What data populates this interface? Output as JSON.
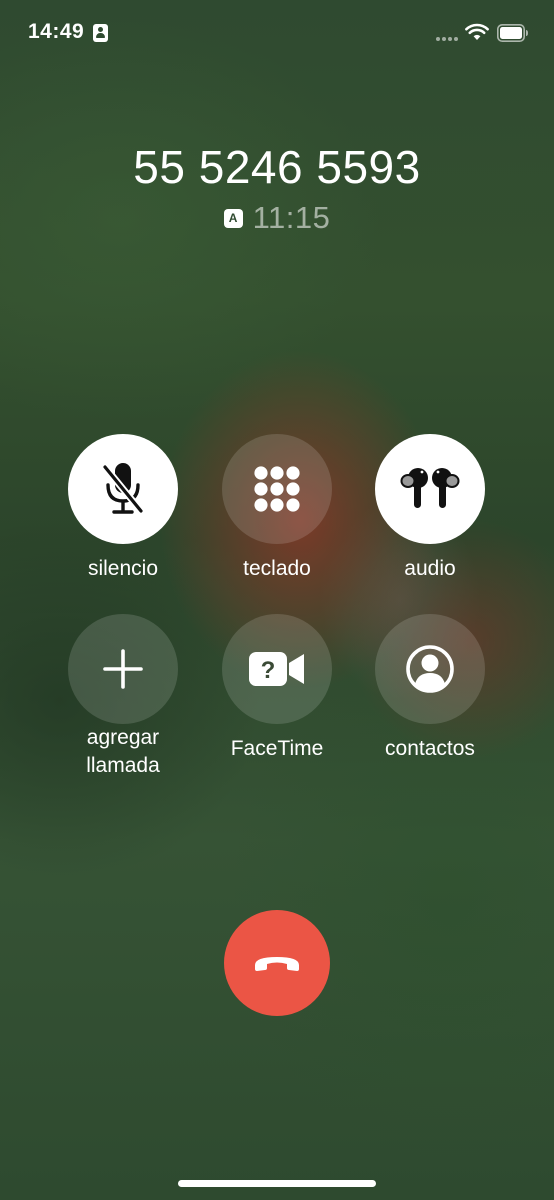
{
  "status_bar": {
    "time": "14:49",
    "icons": [
      "contact-badge-icon",
      "signal-icon",
      "wifi-icon",
      "battery-icon"
    ]
  },
  "call": {
    "number": "55 5246 5593",
    "sim_label": "A",
    "duration": "11:15"
  },
  "controls": [
    {
      "id": "mute",
      "label": "silencio",
      "icon": "microphone-slash-icon",
      "style": "light"
    },
    {
      "id": "keypad",
      "label": "teclado",
      "icon": "keypad-icon",
      "style": "glass"
    },
    {
      "id": "audio",
      "label": "audio",
      "icon": "airpods-icon",
      "style": "light"
    },
    {
      "id": "add-call",
      "label": "agregar\nllamada",
      "icon": "plus-icon",
      "style": "glass"
    },
    {
      "id": "facetime",
      "label": "FaceTime",
      "icon": "facetime-icon",
      "style": "glass"
    },
    {
      "id": "contacts",
      "label": "contactos",
      "icon": "contact-icon",
      "style": "glass"
    }
  ],
  "end_call": {
    "icon": "end-call-icon",
    "color": "#EB5545"
  },
  "colors": {
    "accent_end": "#EB5545",
    "button_light": "#FFFFFF"
  }
}
